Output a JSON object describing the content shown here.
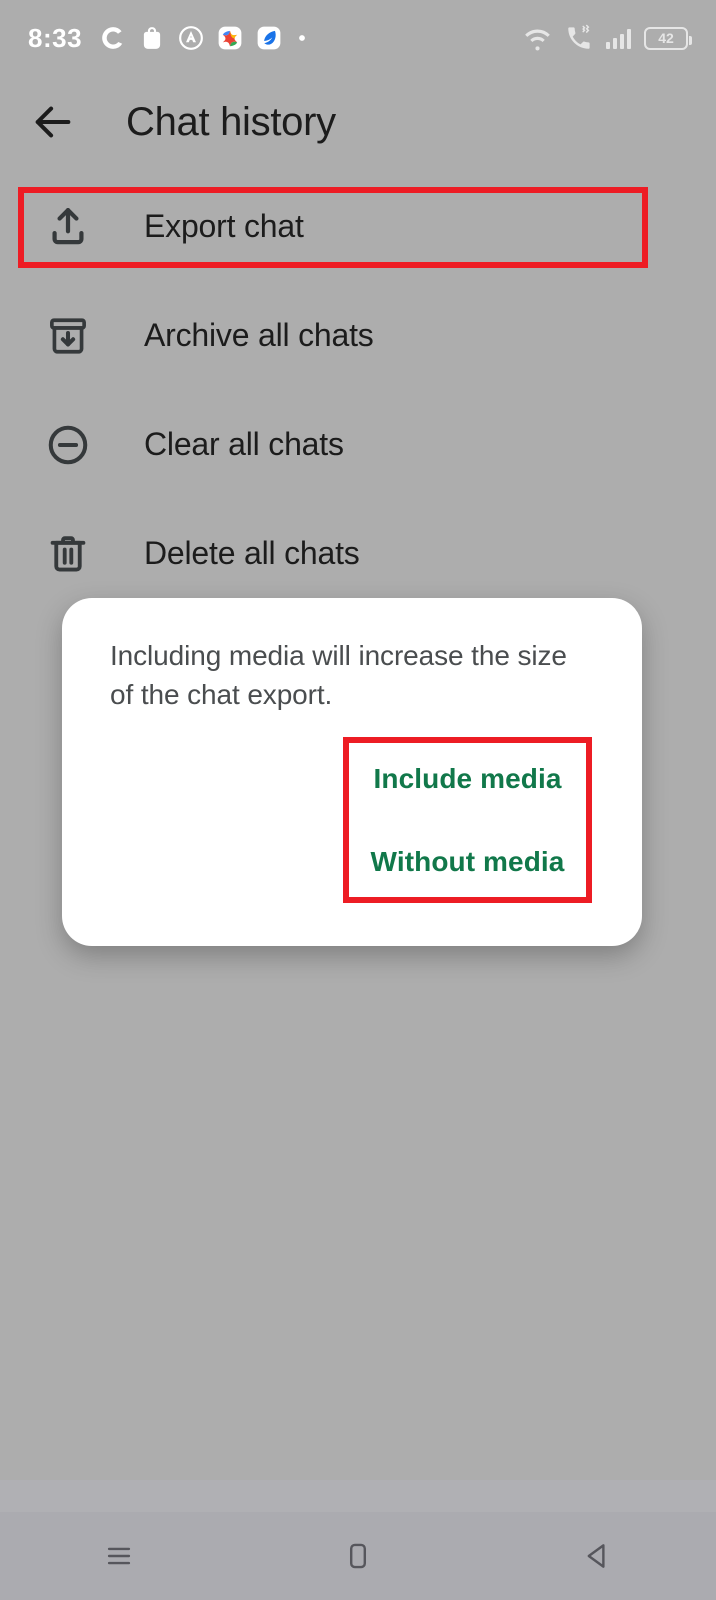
{
  "status_bar": {
    "clock": "8:33",
    "left_icons": [
      {
        "name": "sync-c-icon"
      },
      {
        "name": "bag-icon"
      },
      {
        "name": "alliance-a-icon"
      },
      {
        "name": "photos-star-icon"
      },
      {
        "name": "blue-leaf-app-icon"
      },
      {
        "name": "dot-icon"
      }
    ],
    "right_icons": [
      {
        "name": "wifi-icon"
      },
      {
        "name": "call-vibrate-icon"
      },
      {
        "name": "cellular-signal-icon"
      }
    ],
    "battery_level": "42"
  },
  "app_bar": {
    "back_icon": "arrow-left-icon",
    "title": "Chat history"
  },
  "menu": {
    "items": [
      {
        "icon": "upload-export-icon",
        "label": "Export chat"
      },
      {
        "icon": "archive-box-icon",
        "label": "Archive all chats"
      },
      {
        "icon": "minus-circle-icon",
        "label": "Clear all chats"
      },
      {
        "icon": "trash-icon",
        "label": "Delete all chats"
      }
    ]
  },
  "dialog": {
    "message": "Including media will increase the size of the chat export.",
    "buttons": [
      {
        "label": "Include media"
      },
      {
        "label": "Without media"
      }
    ]
  },
  "nav_bar": {
    "recents_icon": "menu-lines-icon",
    "home_icon": "home-rounded-square-icon",
    "back_icon": "back-triangle-icon"
  },
  "annotations": {
    "export_highlight": "red-highlight-box",
    "dialog_actions_highlight": "red-highlight-box"
  },
  "colors": {
    "background": "#ADADAD",
    "dialog_surface": "#FFFFFF",
    "accent_green": "#11784A",
    "annotation_red": "#ED1C24",
    "text_primary": "#1C1C1C",
    "text_secondary": "#4A4D4F",
    "nav_bar": "#ABABB0"
  }
}
